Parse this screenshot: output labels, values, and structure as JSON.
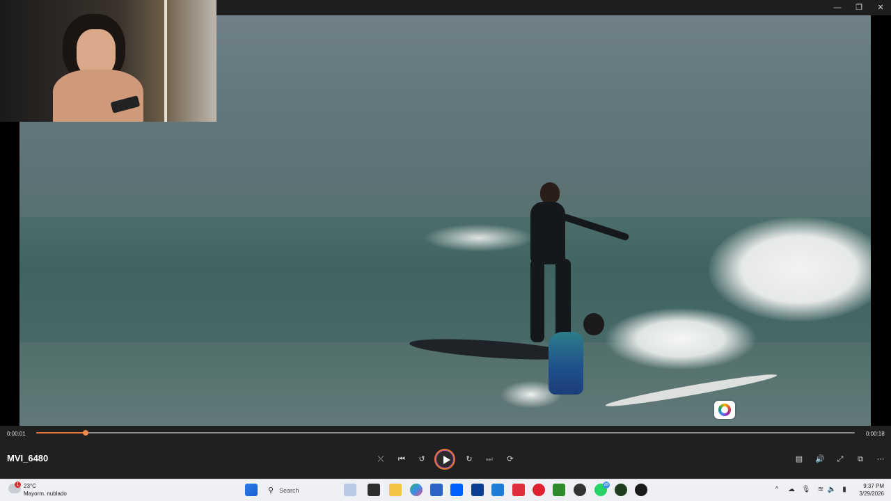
{
  "window": {
    "minimize_icon": "minimize-icon",
    "maximize_icon": "restore-icon",
    "close_icon": "close-icon"
  },
  "player": {
    "file_name": "MVI_6480",
    "elapsed": "0:00:01",
    "duration": "0:00:18",
    "progress_fraction": 0.06,
    "accent_color": "#e9743b"
  },
  "controls": {
    "shuffle_icon": "shuffle-icon",
    "previous_icon": "previous-icon",
    "rewind_icon": "rewind-10-icon",
    "play_icon": "play-icon",
    "forward_icon": "forward-30-icon",
    "next_icon": "next-icon",
    "repeat_icon": "repeat-off-icon",
    "subtitles_icon": "subtitles-icon",
    "volume_icon": "volume-icon",
    "fullscreen_icon": "fullscreen-icon",
    "miniplayer_icon": "miniplayer-icon",
    "more_icon": "more-icon"
  },
  "taskbar": {
    "weather_badge": "1",
    "weather_temp": "23°C",
    "weather_desc": "Mayorm. nublado",
    "search_label": "Search",
    "whatsapp_badge": "28",
    "time": "9:37 PM",
    "date": "3/29/2026"
  }
}
